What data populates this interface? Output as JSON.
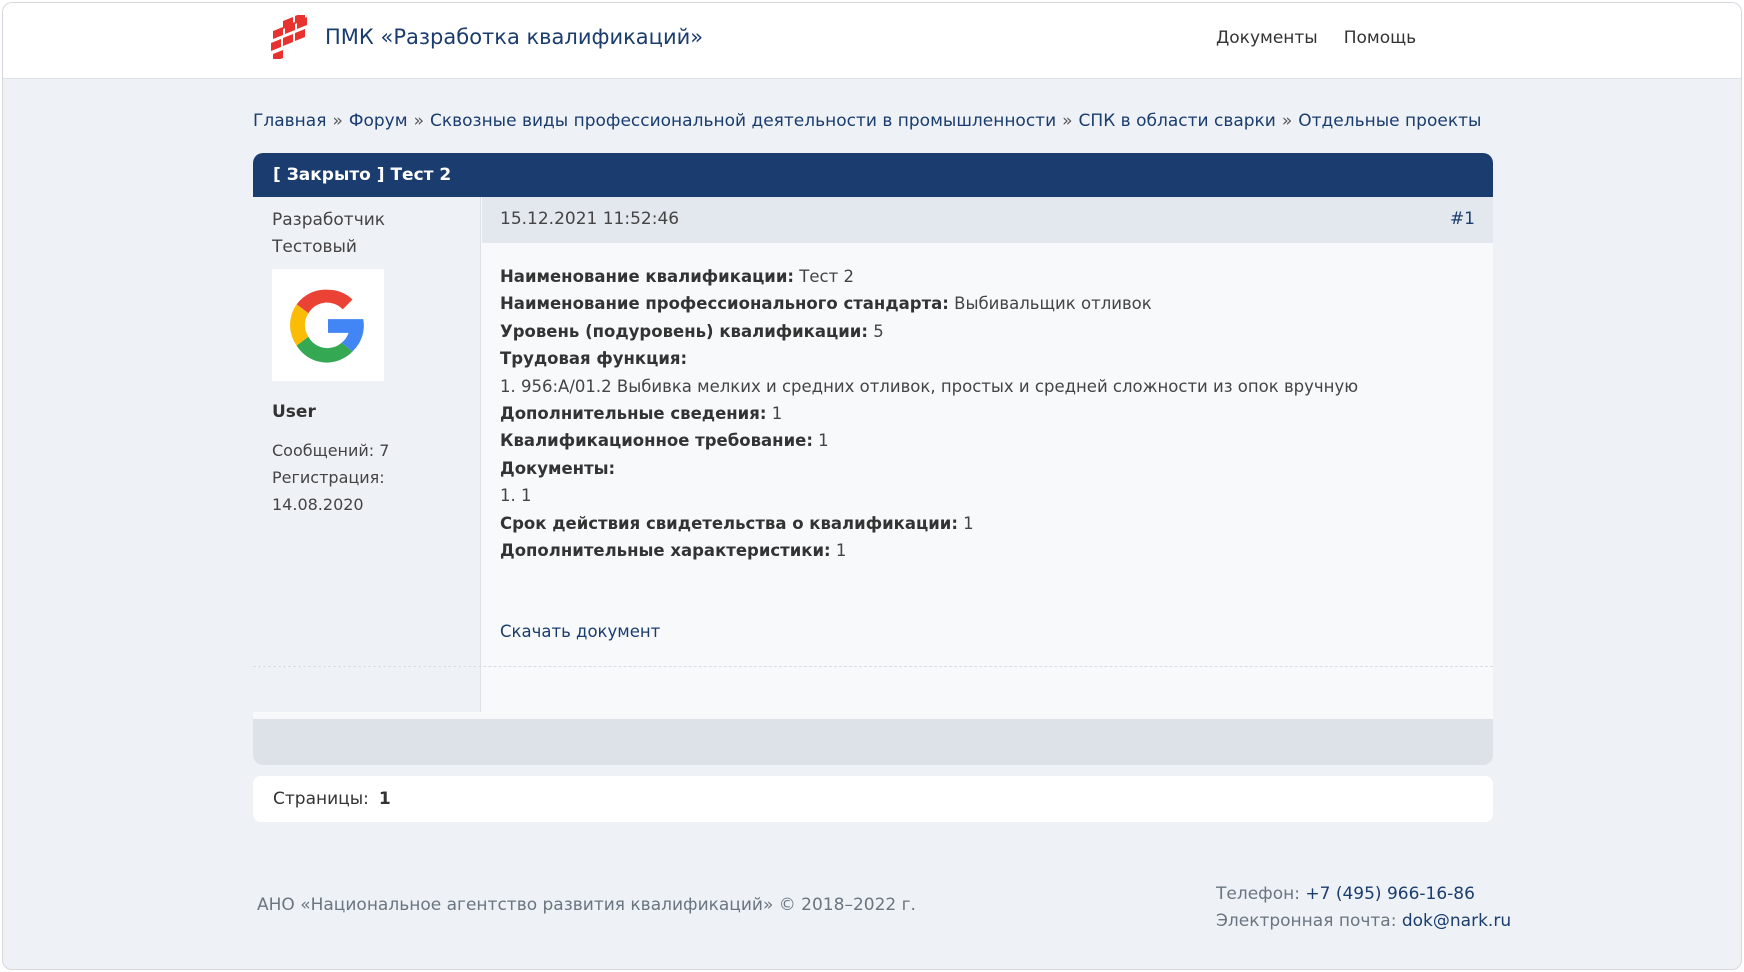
{
  "header": {
    "site_title": "ПМК «Разработка квалификаций»",
    "nav": [
      "Документы",
      "Помощь"
    ]
  },
  "breadcrumb": [
    "Главная",
    "Форум",
    "Сквозные виды профессиональной деятельности в промышленности",
    "СПК в области сварки",
    "Отдельные проекты"
  ],
  "breadcrumb_separator": "»",
  "topic": {
    "title": "[ Закрыто ] Тест 2"
  },
  "post": {
    "author": "Разработчик Тестовый",
    "avatar_icon": "google-g-logo",
    "role": "User",
    "messages_label": "Сообщений:",
    "messages_count": "7",
    "registration_label": "Регистрация:",
    "registration_date": "14.08.2020",
    "date": "15.12.2021 11:52:46",
    "number": "#1",
    "fields": [
      {
        "label": "Наименование квалификации:",
        "value": "Тест 2"
      },
      {
        "label": "Наименование профессионального стандарта:",
        "value": "Выбивальщик отливок"
      },
      {
        "label": "Уровень (подуровень) квалификации:",
        "value": "5"
      },
      {
        "label": "Трудовая функция:",
        "value": ""
      },
      {
        "label": "",
        "value": "1. 956:A/01.2 Выбивка мелких и средних отливок, простых и средней сложности из опок вручную"
      },
      {
        "label": "Дополнительные сведения:",
        "value": "1"
      },
      {
        "label": "Квалификационное требование:",
        "value": "1"
      },
      {
        "label": "Документы:",
        "value": ""
      },
      {
        "label": "",
        "value": "1. 1"
      },
      {
        "label": "Срок действия свидетельства о квалификации:",
        "value": "1"
      },
      {
        "label": "Дополнительные характеристики:",
        "value": "1"
      }
    ],
    "download_label": "Скачать документ"
  },
  "pager": {
    "label": "Страницы:",
    "current": "1"
  },
  "footer": {
    "copyright": "АНО «Национальное агентство развития квалификаций» © 2018–2022 г.",
    "phone_label": "Телефон:",
    "phone": "+7 (495) 966-16-86",
    "email_label": "Электронная почта:",
    "email": "dok@nark.ru"
  },
  "colors": {
    "brand": "#1a3c6e",
    "logo_red": "#e8322f",
    "background": "#eef2f6"
  }
}
